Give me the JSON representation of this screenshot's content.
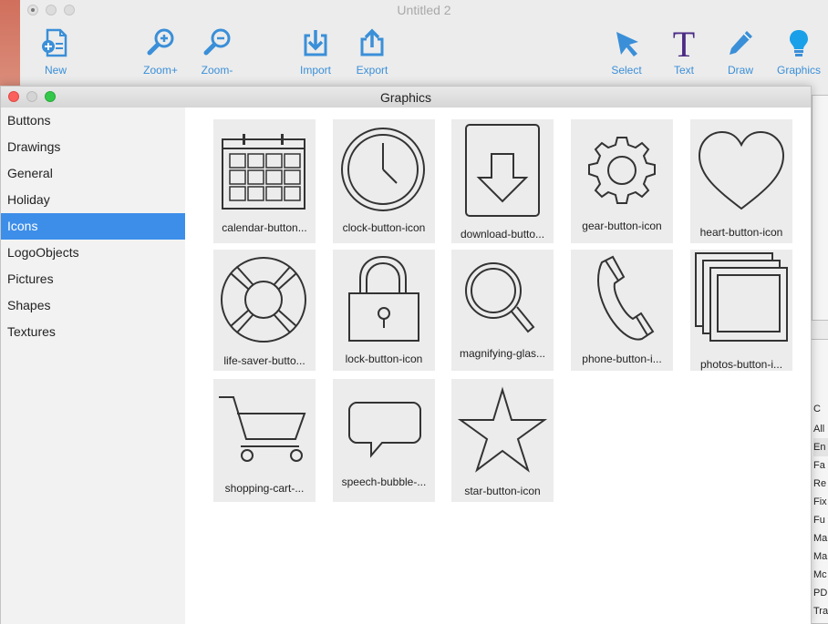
{
  "window": {
    "title": "Untitled 2"
  },
  "toolbar": {
    "new_label": "New",
    "zoom_in_label": "Zoom+",
    "zoom_out_label": "Zoom-",
    "import_label": "Import",
    "export_label": "Export",
    "select_label": "Select",
    "text_label": "Text",
    "draw_label": "Draw",
    "graphics_label": "Graphics",
    "accent_color": "#3a8fd8",
    "text_tool_color": "#4b2a86"
  },
  "panel": {
    "title": "Graphics",
    "categories": [
      "Buttons",
      "Drawings",
      "General",
      "Holiday",
      "Icons",
      "LogoObjects",
      "Pictures",
      "Shapes",
      "Textures"
    ],
    "selected_category": "Icons",
    "selection_color": "#3d8ee9",
    "items": [
      {
        "label": "calendar-button...",
        "icon": "calendar-icon"
      },
      {
        "label": "clock-button-icon",
        "icon": "clock-icon"
      },
      {
        "label": "download-butto...",
        "icon": "download-icon"
      },
      {
        "label": "gear-button-icon",
        "icon": "gear-icon"
      },
      {
        "label": "heart-button-icon",
        "icon": "heart-icon"
      },
      {
        "label": "life-saver-butto...",
        "icon": "life-saver-icon"
      },
      {
        "label": "lock-button-icon",
        "icon": "lock-icon"
      },
      {
        "label": "magnifying-glas...",
        "icon": "magnifying-glass-icon"
      },
      {
        "label": "phone-button-i...",
        "icon": "phone-icon"
      },
      {
        "label": "photos-button-i...",
        "icon": "photos-icon"
      },
      {
        "label": "shopping-cart-...",
        "icon": "shopping-cart-icon"
      },
      {
        "label": "speech-bubble-...",
        "icon": "speech-bubble-icon"
      },
      {
        "label": "star-button-icon",
        "icon": "star-icon"
      }
    ]
  },
  "side_panel": {
    "header": "C",
    "items": [
      "All",
      "En",
      "Fa",
      "Re",
      "Fix",
      "Fu",
      "Ma",
      "Ma",
      "Mc",
      "PD",
      "Tra"
    ]
  }
}
